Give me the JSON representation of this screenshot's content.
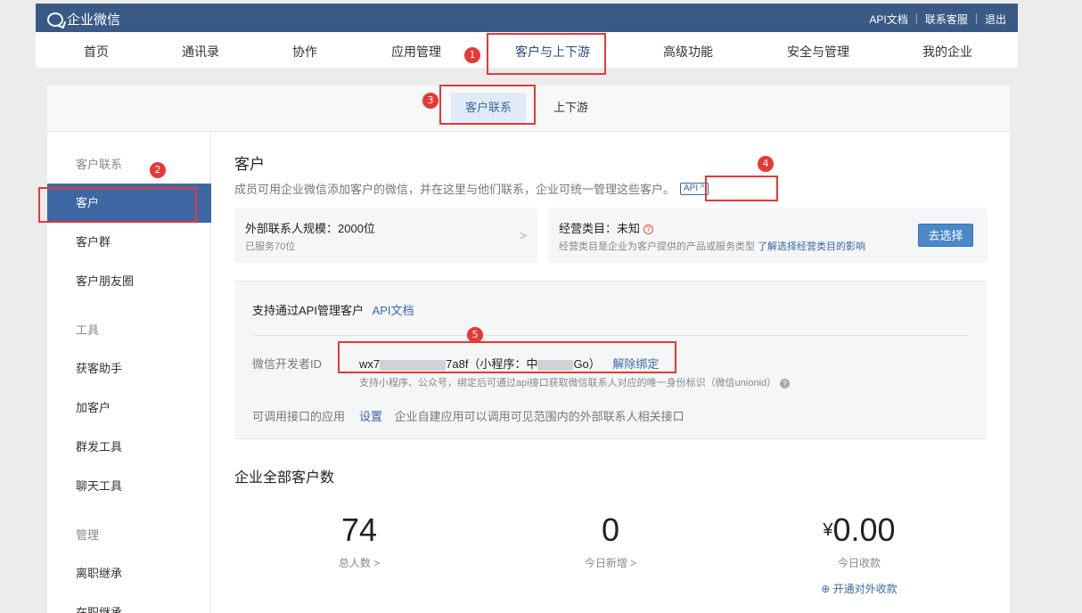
{
  "header": {
    "logo_text": "企业微信",
    "links": [
      "API文档",
      "联系客服",
      "退出"
    ],
    "separator": "|"
  },
  "nav": {
    "items": [
      "首页",
      "通讯录",
      "协作",
      "应用管理",
      "客户与上下游",
      "高级功能",
      "安全与管理",
      "我的企业"
    ],
    "active_index": 4
  },
  "subtabs": {
    "items": [
      "客户联系",
      "上下游"
    ],
    "active_index": 0
  },
  "sidebar": {
    "groups": [
      {
        "title": "客户联系",
        "items": [
          "客户",
          "客户群",
          "客户朋友圈"
        ]
      },
      {
        "title": "工具",
        "items": [
          "获客助手",
          "加客户",
          "群发工具",
          "聊天工具"
        ]
      },
      {
        "title": "管理",
        "items": [
          "离职继承",
          "在职继承"
        ]
      }
    ],
    "active_item": "客户"
  },
  "main": {
    "title": "客户",
    "description": "成员可用企业微信添加客户的微信，并在这里与他们联系，企业可统一管理这些客户。",
    "api_badge": "API",
    "api_badge_arrow": "^",
    "scale_card": {
      "line1": "外部联系人规模：2000位",
      "line2": "已服务70位",
      "chevron": ">"
    },
    "category_card": {
      "line1": "经营类目：未知",
      "help": "?",
      "line2": "经营类目是企业为客户提供的产品或服务类型",
      "link": "了解选择经营类目的影响",
      "button": "去选择"
    },
    "api_section": {
      "support_text": "支持通过API管理客户",
      "api_doc_link": "API文档",
      "dev_id_label": "微信开发者ID",
      "dev_id_prefix": "wx7",
      "dev_id_suffix": "7a8f（小程序：中",
      "dev_id_tail": "Go）",
      "unbind_link": "解除绑定",
      "dev_id_note": "支持小程序、公众号，绑定后可通过api接口获取微信联系人对应的唯一身份标识（微信unionid）",
      "note_help": "?",
      "callable_label": "可调用接口的应用",
      "settings_link": "设置",
      "callable_desc": "企业自建应用可以调用可见范围内的外部联系人相关接口"
    },
    "stats": {
      "title": "企业全部客户数",
      "total": {
        "value": "74",
        "label": "总人数",
        "arrow": ">"
      },
      "today_new": {
        "value": "0",
        "label": "今日新增",
        "arrow": ">"
      },
      "today_income": {
        "currency": "¥",
        "value": "0.00",
        "label": "今日收款",
        "extra": "⊕ 开通对外收款"
      }
    }
  },
  "annotations": [
    "1",
    "2",
    "3",
    "4",
    "5"
  ],
  "colors": {
    "header_bg": "#3a5a85",
    "active_blue": "#3d68a3",
    "annotation_red": "#e53935",
    "link": "#3a67a3"
  }
}
